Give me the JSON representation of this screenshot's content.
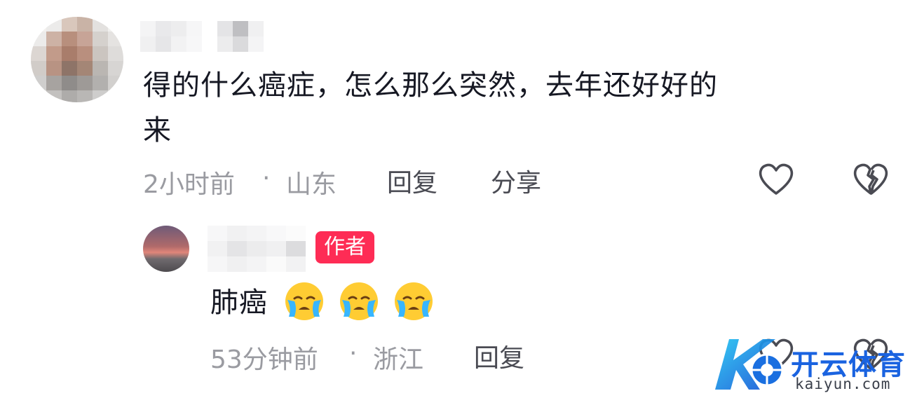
{
  "comment": {
    "text_line1": "得的什么癌症，怎么那么突然，去年还好好的",
    "text_line2": "来",
    "time": "2小时前",
    "separator": "·",
    "location": "山东",
    "reply_label": "回复",
    "share_label": "分享"
  },
  "reply": {
    "author_badge": "作者",
    "text": "肺癌",
    "emoji_name": "crying-face-icon",
    "emoji_count": 3,
    "time": "53分钟前",
    "separator": "·",
    "location": "浙江",
    "reply_label": "回复"
  },
  "watermark": {
    "brand_cn": "开云体育",
    "brand_url": "kaiyun.com"
  },
  "colors": {
    "badge": "#fe2c55",
    "meta_text": "#9a9ba1",
    "watermark_blue": "#1a73e8"
  }
}
